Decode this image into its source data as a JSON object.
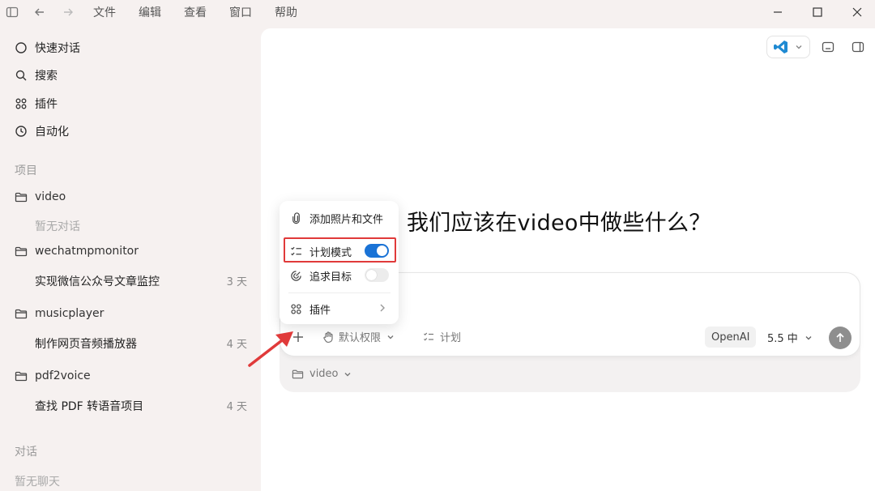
{
  "menu": {
    "file": "文件",
    "edit": "编辑",
    "view": "查看",
    "window": "窗口",
    "help": "帮助"
  },
  "sidebar": {
    "nav": {
      "quick_chat": "快速对话",
      "search": "搜索",
      "plugins": "插件",
      "automation": "自动化"
    },
    "projects_label": "项目",
    "projects": [
      {
        "name": "video",
        "empty": "暂无对话"
      },
      {
        "name": "wechatmpmonitor",
        "conv_title": "实现微信公众号文章监控",
        "conv_age": "3 天"
      },
      {
        "name": "musicplayer",
        "conv_title": "制作网页音频播放器",
        "conv_age": "4 天"
      },
      {
        "name": "pdf2voice",
        "conv_title": "查找 PDF 转语音项目",
        "conv_age": "4 天"
      }
    ],
    "chats_label": "对话",
    "chats_empty": "暂无聊天"
  },
  "main": {
    "heading": "我们应该在video中做些什么？",
    "composer": {
      "permission": "默认权限",
      "plan": "计划",
      "provider": "OpenAI",
      "model": "5.5 中",
      "folder": "video"
    },
    "popup": {
      "add_files": "添加照片和文件",
      "plan_mode": "计划模式",
      "pursue_goal": "追求目标",
      "plugins": "插件",
      "plan_mode_on": true,
      "pursue_goal_on": false
    }
  },
  "colors": {
    "accent": "#1a73d6",
    "highlight_box": "#e03a3a",
    "arrow": "#e03a3a",
    "vscode_blue": "#1f8ad2"
  },
  "icons": {
    "sidebar_toggle": "sidebar-toggle-icon",
    "back": "arrow-left-icon",
    "forward": "arrow-right-icon",
    "minimize": "minimize-icon",
    "maximize": "maximize-icon",
    "close": "close-icon"
  }
}
